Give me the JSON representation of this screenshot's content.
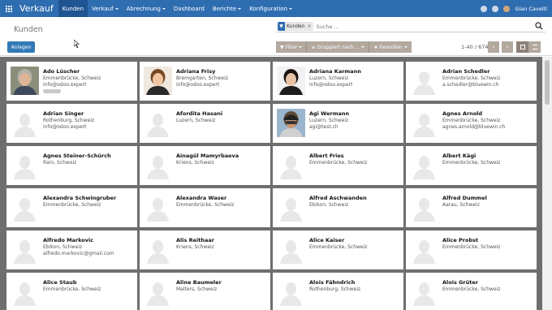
{
  "navbar": {
    "brand": "Verkauf",
    "menu": [
      {
        "label": "Kunden",
        "active": true,
        "dropdown": false
      },
      {
        "label": "Verkauf",
        "active": false,
        "dropdown": true
      },
      {
        "label": "Abrechnung",
        "active": false,
        "dropdown": true
      },
      {
        "label": "Dashboard",
        "active": false,
        "dropdown": false
      },
      {
        "label": "Berichte",
        "active": false,
        "dropdown": true
      },
      {
        "label": "Konfiguration",
        "active": false,
        "dropdown": true
      }
    ],
    "user_name": "Gian Caveltl"
  },
  "control_panel": {
    "title": "Kunden",
    "create_label": "Anlegen",
    "search_facet": "Kunden",
    "search_placeholder": "Suche ...",
    "filter_label": "Filter",
    "group_label": "Gruppiert nach ...",
    "favorites_label": "Favoriten",
    "pager": "1-40 / 674"
  },
  "cards": [
    {
      "name": "Ado Lüscher",
      "line1": "Emmenbrücke, Schweiz",
      "line2": "info@odoo.expert",
      "photo": "man-gray",
      "tag": true
    },
    {
      "name": "Adriana Frisy",
      "line1": "Bremgarten, Schweiz",
      "line2": "info@odoo.expert",
      "photo": "woman-brown"
    },
    {
      "name": "Adriana Karmann",
      "line1": "Luzern, Schweiz",
      "line2": "info@odoo.expert",
      "photo": "woman-dark"
    },
    {
      "name": "Adrian Schedler",
      "line1": "Emmenbrücke, Schweiz",
      "line2": "a.schedler@bluewin.ch",
      "photo": ""
    },
    {
      "name": "Adrian Singer",
      "line1": "Rothenburg, Schweiz",
      "line2": "info@odoo.expert",
      "photo": ""
    },
    {
      "name": "Afordita Hasani",
      "line1": "Luzern, Schweiz",
      "line2": "",
      "photo": ""
    },
    {
      "name": "Agi Wermann",
      "line1": "Luzern, Schweiz",
      "line2": "agi@test.ch",
      "photo": "man-cap"
    },
    {
      "name": "Agnes Arnold",
      "line1": "Emmenbrücke, Schweiz",
      "line2": "agnes.arnold@bluewin.ch",
      "photo": ""
    },
    {
      "name": "Agnes Steiner-Schürch",
      "line1": "Rain, Schweiz",
      "line2": "",
      "photo": ""
    },
    {
      "name": "Ainagül Mamyrbaeva",
      "line1": "Kriens, Schweiz",
      "line2": "",
      "photo": ""
    },
    {
      "name": "Albert Fries",
      "line1": "Emmenbrücke, Schweiz",
      "line2": "",
      "photo": ""
    },
    {
      "name": "Albert Kägi",
      "line1": "Emmenbrücke, Schweiz",
      "line2": "",
      "photo": ""
    },
    {
      "name": "Alexandra Schwingruber",
      "line1": "Emmenbrücke, Schweiz",
      "line2": "",
      "photo": ""
    },
    {
      "name": "Alexandra Waser",
      "line1": "Emmenbrücke, Schweiz",
      "line2": "",
      "photo": ""
    },
    {
      "name": "Alfred Aschwanden",
      "line1": "Ebikon, Schweiz",
      "line2": "",
      "photo": ""
    },
    {
      "name": "Alfred Dummel",
      "line1": "Aarau, Schweiz",
      "line2": "",
      "photo": ""
    },
    {
      "name": "Alfredo Markovic",
      "line1": "Ebikon, Schweiz",
      "line2": "alfredo.markovic@gmail.com",
      "photo": ""
    },
    {
      "name": "Alis Reithaar",
      "line1": "Kriens, Schweiz",
      "line2": "",
      "photo": ""
    },
    {
      "name": "Alice Kaiser",
      "line1": "Emmenbrücke, Schweiz",
      "line2": "",
      "photo": ""
    },
    {
      "name": "Alice Probst",
      "line1": "Emmenbrücke, Schweiz",
      "line2": "",
      "photo": ""
    },
    {
      "name": "Alice Staub",
      "line1": "Emmenbrücke, Schweiz",
      "line2": "",
      "photo": ""
    },
    {
      "name": "Aline Baumeler",
      "line1": "Malters, Schweiz",
      "line2": "",
      "photo": ""
    },
    {
      "name": "Alois Fähndrich",
      "line1": "Rothenburg, Schweiz",
      "line2": "",
      "photo": ""
    },
    {
      "name": "Alois Grüter",
      "line1": "Emmenbrücke, Schweiz",
      "line2": "",
      "photo": ""
    }
  ],
  "colors": {
    "navbar": "#2f6db1",
    "primary_button": "#337ab7",
    "secondary_button": "#b3a99f",
    "kanban_background": "#6e6e6e"
  }
}
